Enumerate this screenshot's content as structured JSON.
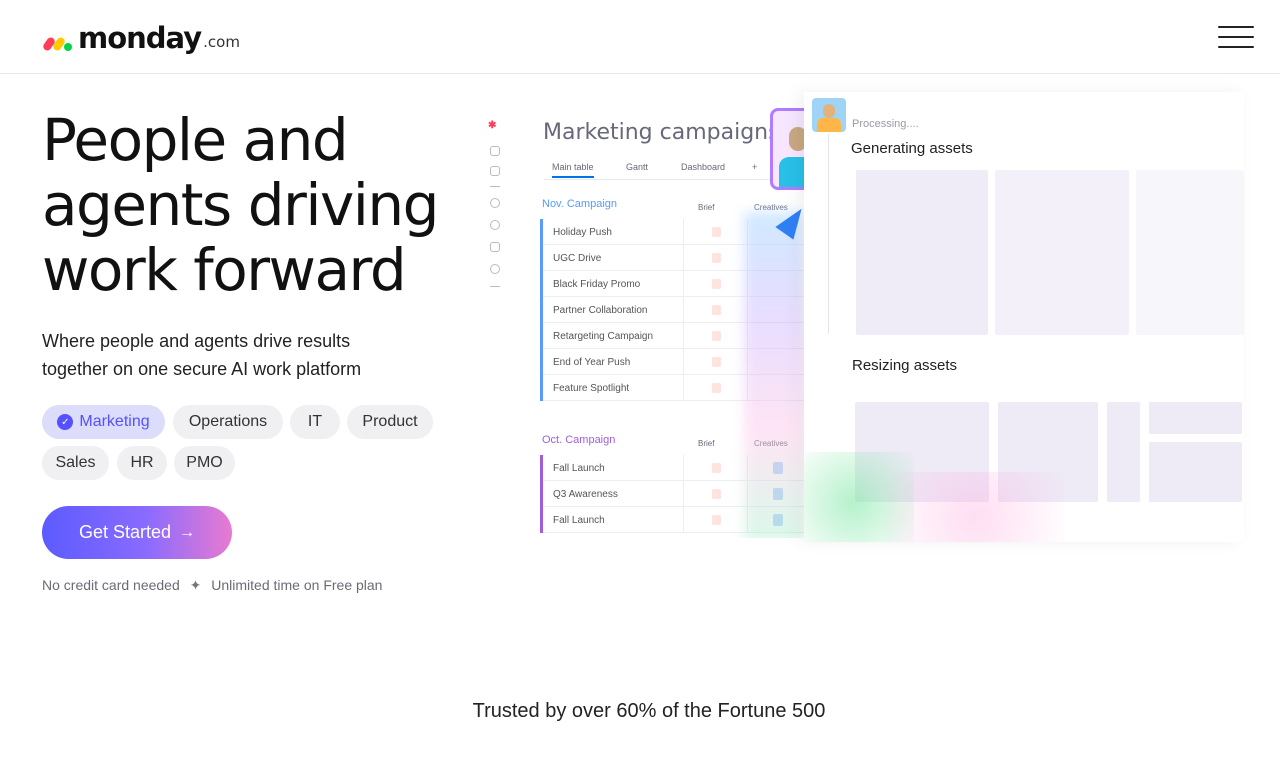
{
  "header": {
    "logo_text": "monday",
    "logo_suffix": ".com",
    "menu_icon": "hamburger-menu-icon"
  },
  "hero": {
    "title_line1": "People and",
    "title_line2": "agents driving",
    "title_line3": "work forward",
    "subtitle_line1": "Where people and agents drive results",
    "subtitle_line2": "together on one secure AI work platform",
    "chips": [
      {
        "label": "Marketing",
        "selected": true
      },
      {
        "label": "Operations",
        "selected": false
      },
      {
        "label": "IT",
        "selected": false
      },
      {
        "label": "Product",
        "selected": false
      },
      {
        "label": "Sales",
        "selected": false
      },
      {
        "label": "HR",
        "selected": false
      },
      {
        "label": "PMO",
        "selected": false
      }
    ],
    "cta_label": "Get Started",
    "cta_arrow": "→",
    "note_part1": "No credit card needed",
    "note_separator": "✦",
    "note_part2": "Unlimited time on Free plan"
  },
  "board": {
    "title": "Marketing campaigns",
    "tabs": [
      "Main table",
      "Gantt",
      "Dashboard",
      "+"
    ],
    "groups": [
      {
        "title": "Nov. Campaign",
        "color": "#579bfc",
        "columns": [
          "Brief",
          "Creatives"
        ],
        "rows": [
          "Holiday Push",
          "UGC Drive",
          "Black Friday Promo",
          "Partner Collaboration",
          "Retargeting Campaign",
          "End of Year Push",
          "Feature Spotlight"
        ]
      },
      {
        "title": "Oct. Campaign",
        "color": "#a25ddc",
        "columns": [
          "Brief",
          "Creatives"
        ],
        "rows": [
          "Fall Launch",
          "Q3 Awareness",
          "Fall Launch"
        ]
      }
    ]
  },
  "agent_panel": {
    "status": "Processing....",
    "step1": "Generating assets",
    "step2": "Resizing assets"
  },
  "trusted": "Trusted by over 60% of the Fortune 500",
  "colors": {
    "brand_purple": "#5551ff",
    "chip_active_bg": "#dcdcfb",
    "cta_gradient_start": "#5c5bff",
    "cta_gradient_end": "#e87ad0"
  }
}
